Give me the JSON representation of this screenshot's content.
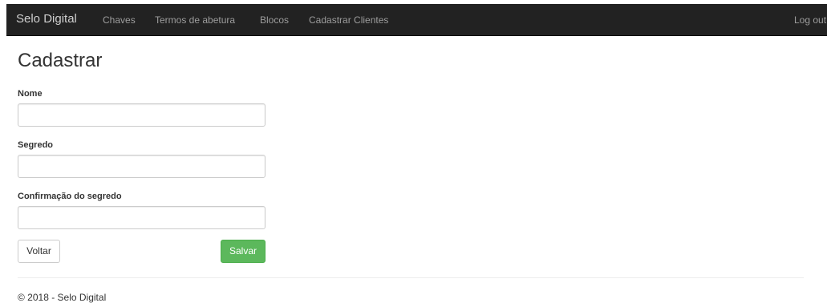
{
  "navbar": {
    "brand": "Selo Digital",
    "links": [
      "Chaves",
      "Termos de abetura",
      "Blocos",
      "Cadastrar Clientes"
    ],
    "logout": "Log out"
  },
  "page": {
    "title": "Cadastrar"
  },
  "form": {
    "nome": {
      "label": "Nome",
      "value": ""
    },
    "segredo": {
      "label": "Segredo",
      "value": ""
    },
    "confirmacao": {
      "label": "Confirmação do segredo",
      "value": ""
    }
  },
  "actions": {
    "back_label": "Voltar",
    "save_label": "Salvar"
  },
  "footer": {
    "text": "© 2018 - Selo Digital"
  },
  "colors": {
    "navbar_bg": "#222222",
    "save_button": "#5cb85c"
  }
}
